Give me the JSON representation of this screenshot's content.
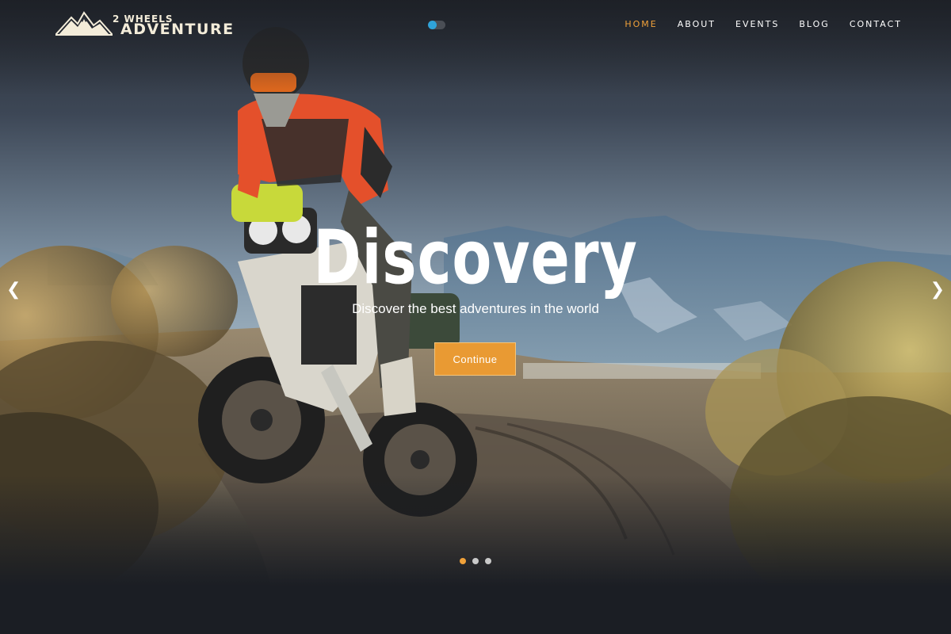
{
  "brand": {
    "small": "2 WHEELS",
    "big": "ADVENTURE"
  },
  "nav": {
    "items": [
      {
        "label": "HOME",
        "active": true
      },
      {
        "label": "ABOUT",
        "active": false
      },
      {
        "label": "EVENTS",
        "active": false
      },
      {
        "label": "BLOG",
        "active": false
      },
      {
        "label": "CONTACT",
        "active": false
      }
    ]
  },
  "hero": {
    "headline": "Discovery",
    "subtitle": "Discover the best adventures in the world",
    "cta_label": "Continue",
    "prev_arrow": "❮",
    "next_arrow": "❯"
  },
  "slider": {
    "slide_count": 3,
    "active_index": 0
  },
  "theme_toggle": {
    "on": true,
    "color": "#2fa3d9"
  },
  "colors": {
    "accent": "#f0a13a",
    "button": "#e99a33"
  }
}
